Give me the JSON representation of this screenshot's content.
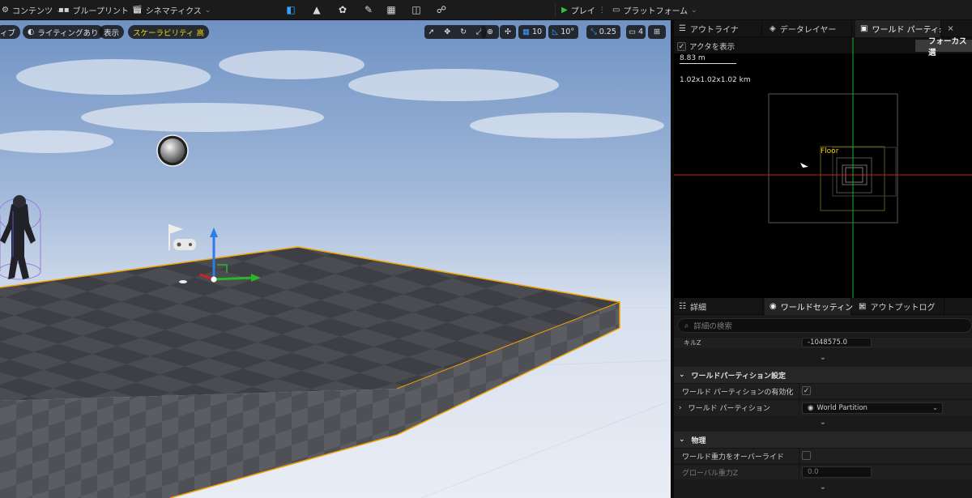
{
  "toolbar": {
    "content_label": "コンテンツ",
    "blueprint_label": "ブループリント",
    "cinematics_label": "シネマティクス",
    "play_label": "プレイ",
    "platform_label": "プラットフォーム"
  },
  "viewport": {
    "perspective_label": "ィブ",
    "lighting_label": "ライティングあり",
    "show_label": "表示",
    "scalability_label": "スケーラビリティ 高",
    "grid_snap": "10",
    "rotation_snap": "10°",
    "scale_snap": "0.25",
    "camera_speed": "4"
  },
  "outliner_tabs": {
    "outliner": "アウトライナ",
    "data_layers": "データレイヤー",
    "world_partition": "ワールド パーティ:"
  },
  "world_partition": {
    "show_actors_label": "アクタを表示",
    "focus_button": "フォーカス選",
    "scale_text": "8.83 m",
    "size_text": "1.02x1.02x1.02 km",
    "floor_label": "Floor"
  },
  "details_tabs": {
    "details": "詳細",
    "world_settings": "ワールドセッティン",
    "output_log": "アウトプットログ"
  },
  "details": {
    "search_placeholder": "詳細の検索",
    "clipped_label": "キルZ",
    "clipped_value": "-1048575.0",
    "section_world_partition": "ワールドパーティション設定",
    "enable_wp_label": "ワールド パーティションの有効化",
    "world_partition_label": "ワールド パーティション",
    "world_partition_value": "World Partition",
    "section_physics": "物理",
    "override_gravity_label": "ワールド重力をオーバーライド",
    "global_gravity_label": "グローバル重力Z",
    "global_gravity_value": "0.0"
  },
  "colors": {
    "selection_orange": "#f2a200",
    "play_green": "#35c33e",
    "axis_red": "#d02020",
    "axis_green": "#18b818",
    "scalability_yellow": "#f2d400"
  }
}
